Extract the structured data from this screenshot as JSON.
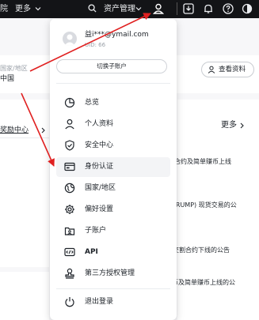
{
  "topbar": {
    "left_label": "院",
    "more_label": "更多",
    "asset_label": "资产管理"
  },
  "background": {
    "region_label": "国家/地区",
    "region_value": "中国",
    "view_profile_label": "查看资料",
    "reward_center_label": "奖励中心",
    "more_label": "更多",
    "announcements": [
      "合约及简单赚币上线",
      "TRUMP) 现货交易的公",
      "交割合约下线的公告",
      "币及简单赚币上线的公"
    ]
  },
  "dropdown": {
    "email": "益i***@ymail.com",
    "uid_prefix": "UID: 66",
    "switch_label": "切换子账户",
    "items": [
      {
        "label": "总览",
        "icon": "pie-chart-icon"
      },
      {
        "label": "个人资料",
        "icon": "user-icon"
      },
      {
        "label": "安全中心",
        "icon": "shield-check-icon"
      },
      {
        "label": "身份认证",
        "icon": "id-card-icon"
      },
      {
        "label": "国家/地区",
        "icon": "globe-icon"
      },
      {
        "label": "偏好设置",
        "icon": "gear-icon"
      },
      {
        "label": "子账户",
        "icon": "sub-account-icon"
      },
      {
        "label": "API",
        "icon": "api-icon"
      },
      {
        "label": "第三方授权管理",
        "icon": "authorization-icon"
      }
    ],
    "active_item": "身份认证",
    "logout_label": "退出登录"
  },
  "annotation_color": "#e02020"
}
